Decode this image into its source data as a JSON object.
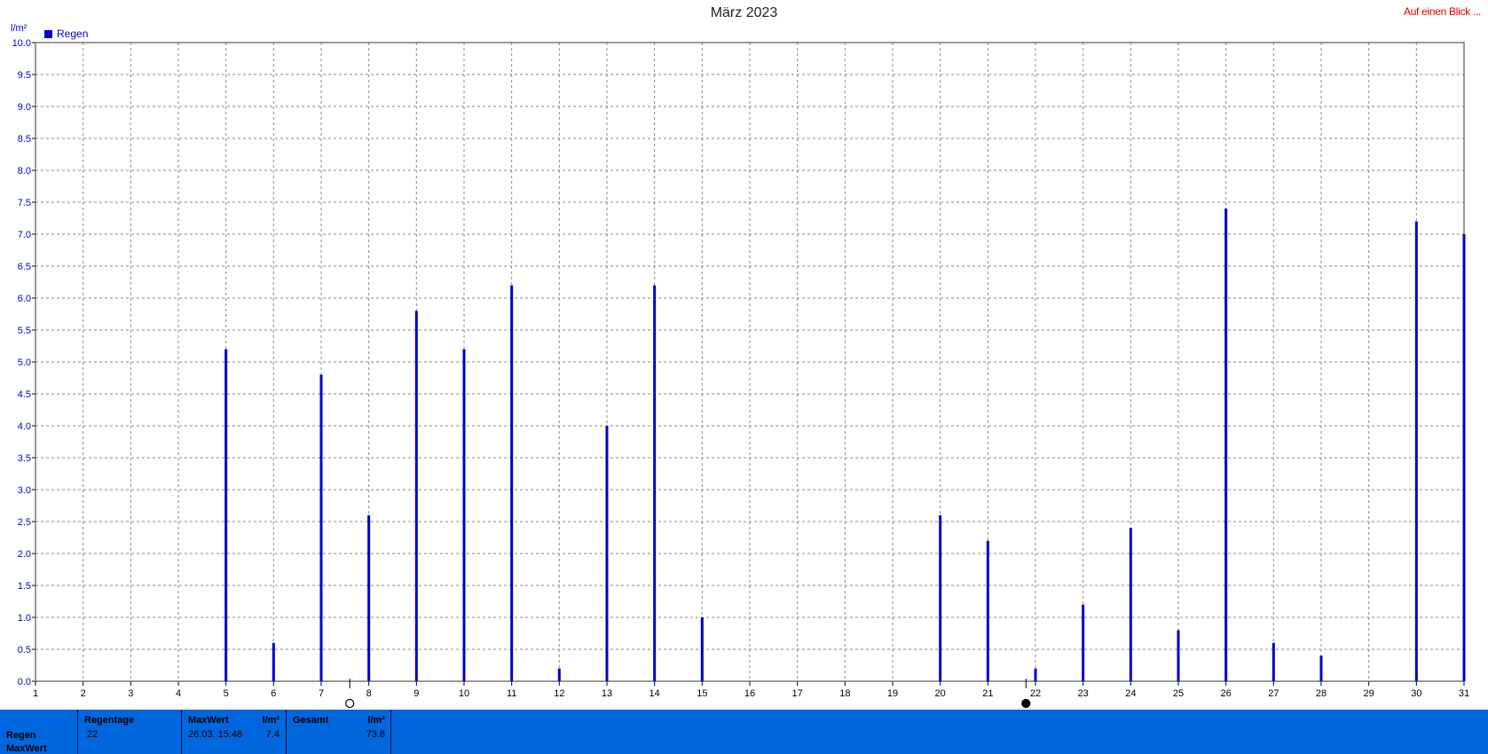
{
  "header": {
    "title": "März 2023",
    "glance_link": "Auf einen Blick ..."
  },
  "legend": {
    "label": "Regen",
    "color": "#0000cc"
  },
  "chart_data": {
    "type": "bar",
    "title": "März 2023",
    "ylabel": "l/m²",
    "xlabel": "",
    "ylim": [
      0,
      10
    ],
    "yticks": [
      "0.0",
      "0.5",
      "1.0",
      "1.5",
      "2.0",
      "2.5",
      "3.0",
      "3.5",
      "4.0",
      "4.5",
      "5.0",
      "5.5",
      "6.0",
      "6.5",
      "7.0",
      "7.5",
      "8.0",
      "8.5",
      "9.0",
      "9.5",
      "10.0"
    ],
    "categories": [
      "1",
      "2",
      "3",
      "4",
      "5",
      "6",
      "7",
      "8",
      "9",
      "10",
      "11",
      "12",
      "13",
      "14",
      "15",
      "16",
      "17",
      "18",
      "19",
      "20",
      "21",
      "22",
      "23",
      "24",
      "25",
      "26",
      "27",
      "28",
      "29",
      "30",
      "31"
    ],
    "grid": true,
    "legend_position": "top-left",
    "series": [
      {
        "name": "Regen",
        "color": "#0000cc",
        "values": [
          0,
          0,
          0,
          0,
          5.2,
          0.6,
          4.8,
          2.6,
          5.8,
          5.2,
          6.2,
          0.2,
          4.0,
          6.2,
          1.0,
          0,
          0,
          0,
          0,
          2.6,
          2.2,
          0.2,
          1.2,
          2.4,
          0.8,
          7.4,
          0.6,
          0.4,
          0,
          7.2,
          7.0
        ]
      }
    ],
    "markers": [
      {
        "symbol": "new-moon",
        "day": 7.6
      },
      {
        "symbol": "full-moon",
        "day": 21.8
      }
    ]
  },
  "stats": {
    "row_labels": [
      "Regen",
      "MaxWert"
    ],
    "regentage": {
      "header": "Regentage",
      "value": "22"
    },
    "maxwert": {
      "header": "MaxWert",
      "unit": "l/m²",
      "date": "26.03.  15:48",
      "value": "7.4"
    },
    "gesamt": {
      "header": "Gesamt",
      "unit": "l/m²",
      "value": "73.8"
    },
    "colors": {
      "bar": "#0066dd",
      "divider": "#0a0a40"
    }
  }
}
